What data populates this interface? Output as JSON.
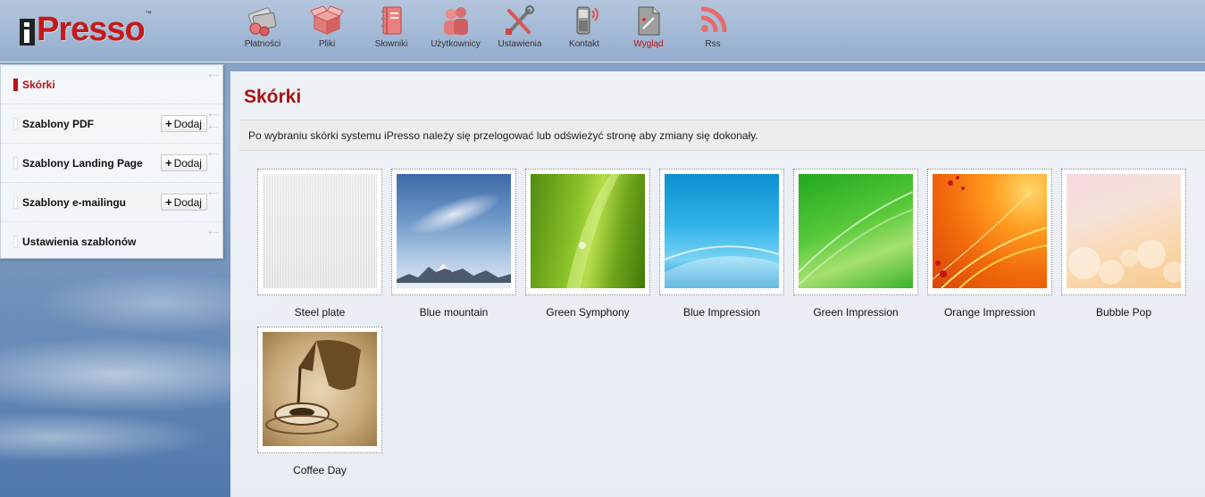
{
  "app": {
    "logo_text": "Presso",
    "logo_tm": "™"
  },
  "topnav": [
    {
      "label": "Płatności",
      "icon": "payments-icon",
      "active": false
    },
    {
      "label": "Pliki",
      "icon": "files-box-icon",
      "active": false
    },
    {
      "label": "Słowniki",
      "icon": "dictionary-book-icon",
      "active": false
    },
    {
      "label": "Użytkownicy",
      "icon": "users-icon",
      "active": false
    },
    {
      "label": "Ustawienia",
      "icon": "tools-icon",
      "active": false
    },
    {
      "label": "Kontakt",
      "icon": "phone-icon",
      "active": false
    },
    {
      "label": "Wygląd",
      "icon": "appearance-icon",
      "active": true
    },
    {
      "label": "Rss",
      "icon": "rss-icon",
      "active": false
    }
  ],
  "sidebar": {
    "items": [
      {
        "label": "Skórki",
        "active": true
      },
      {
        "label": "Szablony PDF",
        "add_label": "Dodaj"
      },
      {
        "label": "Szablony Landing Page",
        "add_label": "Dodaj"
      },
      {
        "label": "Szablony e-mailingu",
        "add_label": "Dodaj"
      },
      {
        "label": "Ustawienia szablonów"
      }
    ]
  },
  "main": {
    "title": "Skórki",
    "info": "Po wybraniu skórki systemu iPresso należy się przelogować lub odświeżyć stronę aby zmiany się dokonały.",
    "skins": [
      {
        "label": "Steel plate"
      },
      {
        "label": "Blue mountain"
      },
      {
        "label": "Green Symphony"
      },
      {
        "label": "Blue Impression"
      },
      {
        "label": "Green Impression"
      },
      {
        "label": "Orange Impression"
      },
      {
        "label": "Bubble Pop"
      },
      {
        "label": "Coffee Day"
      }
    ]
  },
  "colors": {
    "accent": "#b51414",
    "header_bg": "#a5bad6"
  }
}
